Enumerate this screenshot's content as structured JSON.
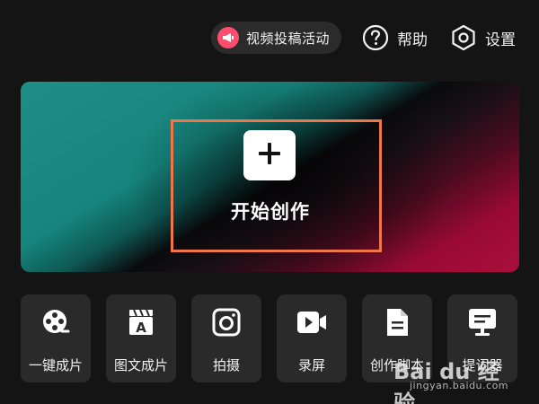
{
  "topbar": {
    "promo": {
      "label": "视频投稿活动",
      "icon": "megaphone-icon"
    },
    "help": {
      "label": "帮助",
      "icon": "question-circle-icon"
    },
    "settings": {
      "label": "设置",
      "icon": "hexagon-settings-icon"
    }
  },
  "hero": {
    "create_label": "开始创作",
    "create_icon": "plus-icon"
  },
  "tools": [
    {
      "label": "一键成片",
      "icon": "film-reel-icon"
    },
    {
      "label": "图文成片",
      "icon": "text-clapboard-icon"
    },
    {
      "label": "拍摄",
      "icon": "camera-icon"
    },
    {
      "label": "录屏",
      "icon": "screen-record-icon"
    },
    {
      "label": "创作脚本",
      "icon": "document-icon"
    },
    {
      "label": "提词器",
      "icon": "teleprompter-icon"
    }
  ],
  "watermark": {
    "logo": "Bai du 经验",
    "url": "jingyan.baidu.com"
  },
  "colors": {
    "background": "#141414",
    "tile": "#2a2a2a",
    "promo_accent": "#ff4d6d",
    "highlight": "#f0764a",
    "hero_teal": "#1f8e86",
    "hero_red": "#aa0f3c"
  }
}
